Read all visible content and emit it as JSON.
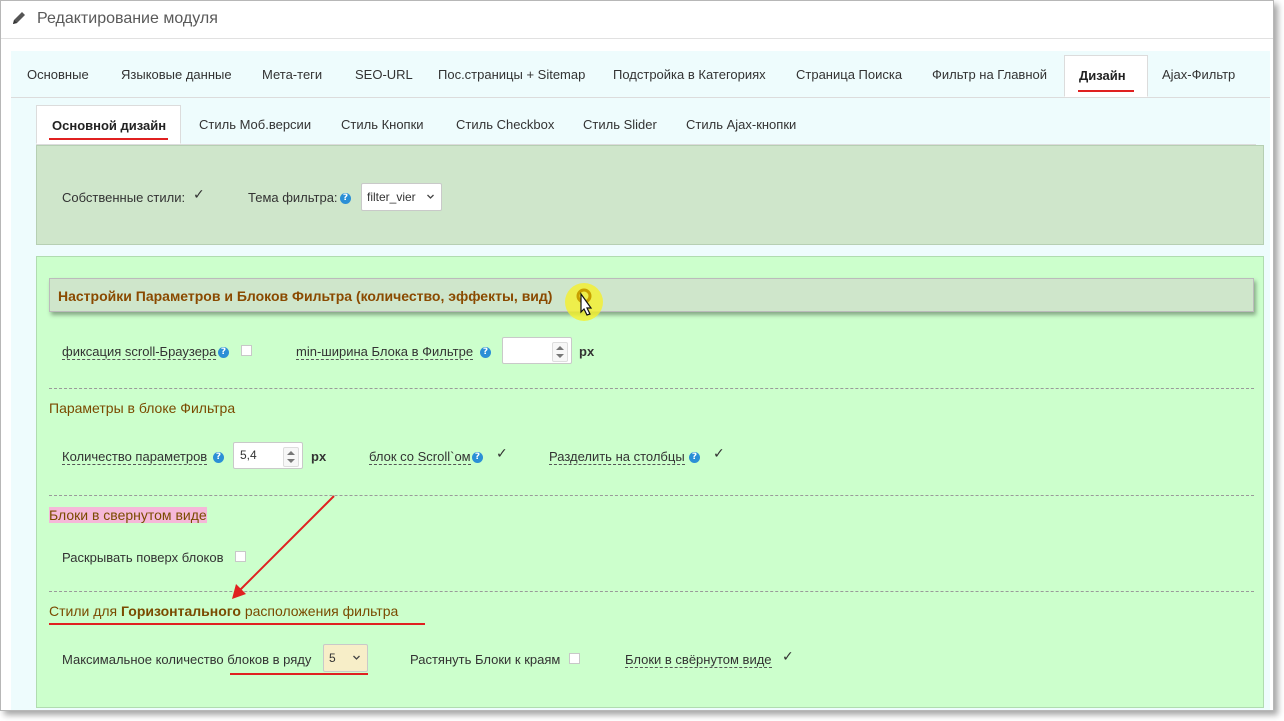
{
  "header": {
    "title": "Редактирование модуля",
    "icon": "pencil-icon"
  },
  "main_tabs": [
    {
      "label": "Основные",
      "active": false
    },
    {
      "label": "Языковые данные",
      "active": false
    },
    {
      "label": "Мета-теги",
      "active": false
    },
    {
      "label": "SEO-URL",
      "active": false
    },
    {
      "label": "Пос.страницы + Sitemap",
      "active": false
    },
    {
      "label": "Подстройка в Категориях",
      "active": false
    },
    {
      "label": "Страница Поиска",
      "active": false
    },
    {
      "label": "Фильтр на Главной",
      "active": false
    },
    {
      "label": "Дизайн",
      "active": true
    },
    {
      "label": "Ajax-Фильтр",
      "active": false
    }
  ],
  "sub_tabs": [
    {
      "label": "Основной дизайн",
      "active": true
    },
    {
      "label": "Стиль Моб.версии",
      "active": false
    },
    {
      "label": "Стиль Кнопки",
      "active": false
    },
    {
      "label": "Стиль Checkbox",
      "active": false
    },
    {
      "label": "Стиль Slider",
      "active": false
    },
    {
      "label": "Стиль Ajax-кнопки",
      "active": false
    }
  ],
  "general": {
    "own_styles_label": "Собственные стили:",
    "own_styles_checked": true,
    "theme_label": "Тема фильтра:",
    "theme_value": "filter_vier"
  },
  "settings": {
    "heading": "Настройки Параметров и Блоков Фильтра (количество, эффекты, вид)",
    "scroll_fix_label": "фиксация scroll-Браузера",
    "scroll_fix_checked": false,
    "min_width_label": "min-ширина Блока в Фильтре",
    "min_width_value": "",
    "min_width_unit": "px"
  },
  "params_section": {
    "heading": "Параметры в блоке Фильтра",
    "count_label": "Количество параметров",
    "count_value": "5,4",
    "count_unit": "px",
    "scroll_label": "блок со Scroll`ом",
    "scroll_checked": true,
    "columns_label": "Разделить на столбцы",
    "columns_checked": true
  },
  "collapsed_section": {
    "heading": "Блоки в свернутом виде",
    "expand_label": "Раскрывать поверх блоков",
    "expand_checked": false
  },
  "horizontal_section": {
    "heading_pre": "Стили для ",
    "heading_bold": "Горизонтального",
    "heading_post": " расположения фильтра",
    "max_label": "Максимальное количество блоков в ряду",
    "max_value": "5",
    "stretch_label": "Растянуть Блоки к краям",
    "stretch_checked": false,
    "collapsed_label": "Блоки в свёрнутом виде",
    "collapsed_checked": true
  },
  "help_glyph": "?",
  "check_glyph": "✓",
  "colors": {
    "accent_red": "#e02020",
    "heading_brown": "#8a4a00",
    "panel_green": "#ccffcc",
    "header_green": "#cfe6cb",
    "highlight_pink": "#f5b8d8",
    "cursor_highlight": "#f5f02a"
  }
}
